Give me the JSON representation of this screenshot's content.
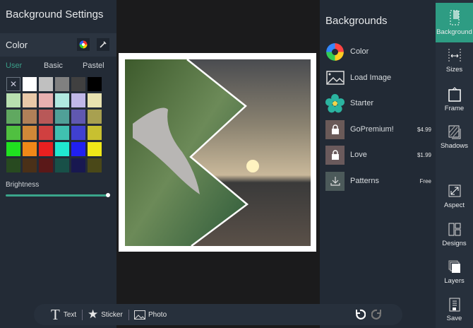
{
  "left_panel": {
    "title": "Background Settings",
    "color_label": "Color",
    "tabs": [
      "User",
      "Basic",
      "Pastel"
    ],
    "active_tab": "User",
    "brightness_label": "Brightness",
    "brightness_value": 1.0,
    "swatches": [
      "none",
      "#ffffff",
      "#c0c0c0",
      "#808080",
      "#404040",
      "#000000",
      "#b8e0b0",
      "#e8c8a8",
      "#e8b0b0",
      "#b0e8e0",
      "#c0b8e8",
      "#e8e2b0",
      "#60a860",
      "#b08058",
      "#b85858",
      "#50a098",
      "#6058b0",
      "#a8a050",
      "#50c040",
      "#d08838",
      "#d04040",
      "#40c0b0",
      "#4040d0",
      "#c8c030",
      "#20e020",
      "#f08818",
      "#e82020",
      "#20e8d0",
      "#2020f0",
      "#f0e818",
      "#284a20",
      "#4a3018",
      "#5a1818",
      "#185048",
      "#181850",
      "#4a4818"
    ]
  },
  "backgrounds": {
    "title": "Backgrounds",
    "items": [
      {
        "name": "Color",
        "price": ""
      },
      {
        "name": "Load Image",
        "price": ""
      },
      {
        "name": "Starter",
        "price": ""
      },
      {
        "name": "GoPremium!",
        "price": "$4.99"
      },
      {
        "name": "Love",
        "price": "$1.99"
      },
      {
        "name": "Patterns",
        "price": "Free"
      }
    ]
  },
  "sidebar": {
    "items": [
      "Background",
      "Sizes",
      "Frame",
      "Shadows",
      "Aspect",
      "Designs",
      "Layers",
      "Save"
    ],
    "active": "Background"
  },
  "toolbar": {
    "text": "Text",
    "sticker": "Sticker",
    "photo": "Photo"
  },
  "colors": {
    "accent": "#2e9c83"
  }
}
